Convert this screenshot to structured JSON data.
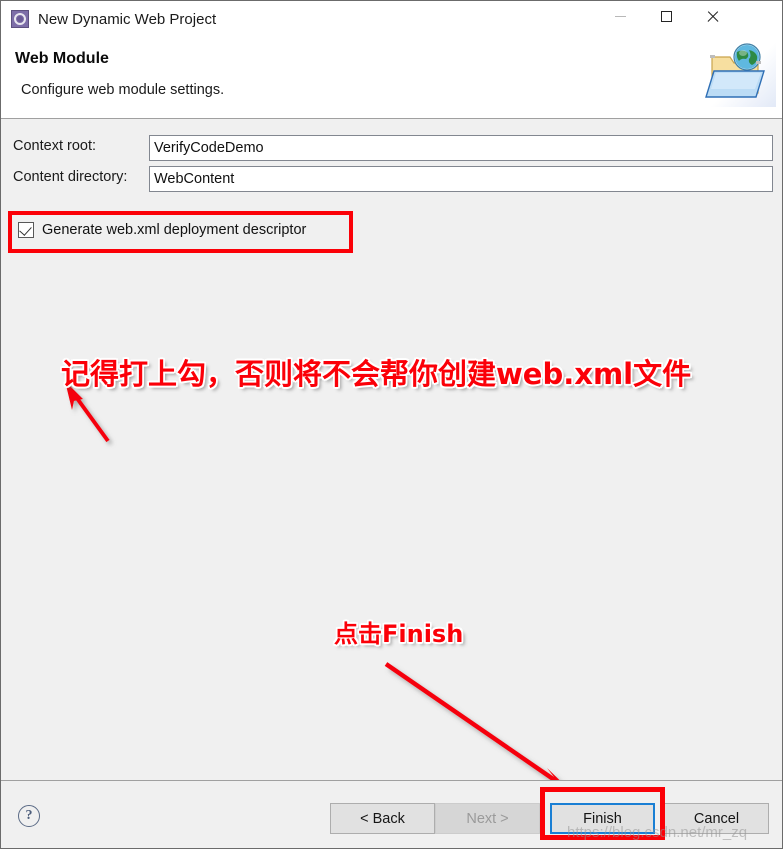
{
  "window": {
    "title": "New Dynamic Web Project",
    "icon": "project-wizard-icon",
    "controls": {
      "minimize": "minimize-icon",
      "maximize": "maximize-icon",
      "close": "close-icon"
    }
  },
  "header": {
    "title": "Web Module",
    "description": "Configure web module settings.",
    "icon": "web-folder-globe-icon"
  },
  "form": {
    "fields": [
      {
        "label": "Context root:",
        "value": "VerifyCodeDemo",
        "placeholder": ""
      },
      {
        "label": "Content directory:",
        "value": "WebContent",
        "placeholder": ""
      }
    ],
    "checkbox": {
      "label": "Generate web.xml deployment descriptor",
      "checked": true
    }
  },
  "annotations": {
    "highlight_color": "#fb0007",
    "text_color": "#fb0008",
    "checkbox_note": "记得打上勾，否则将不会帮你创建web.xml文件",
    "finish_note": "点击Finish",
    "arrow_to_checkbox": "red-arrow-up-left-icon",
    "arrow_to_finish": "red-arrow-down-right-icon"
  },
  "footer": {
    "help": "?",
    "buttons": [
      {
        "label": "< Back",
        "state": "enabled"
      },
      {
        "label": "Next >",
        "state": "disabled"
      },
      {
        "label": "Finish",
        "state": "focused"
      },
      {
        "label": "Cancel",
        "state": "enabled"
      }
    ],
    "watermark": "https://blog.csdn.net/mr_zq"
  }
}
